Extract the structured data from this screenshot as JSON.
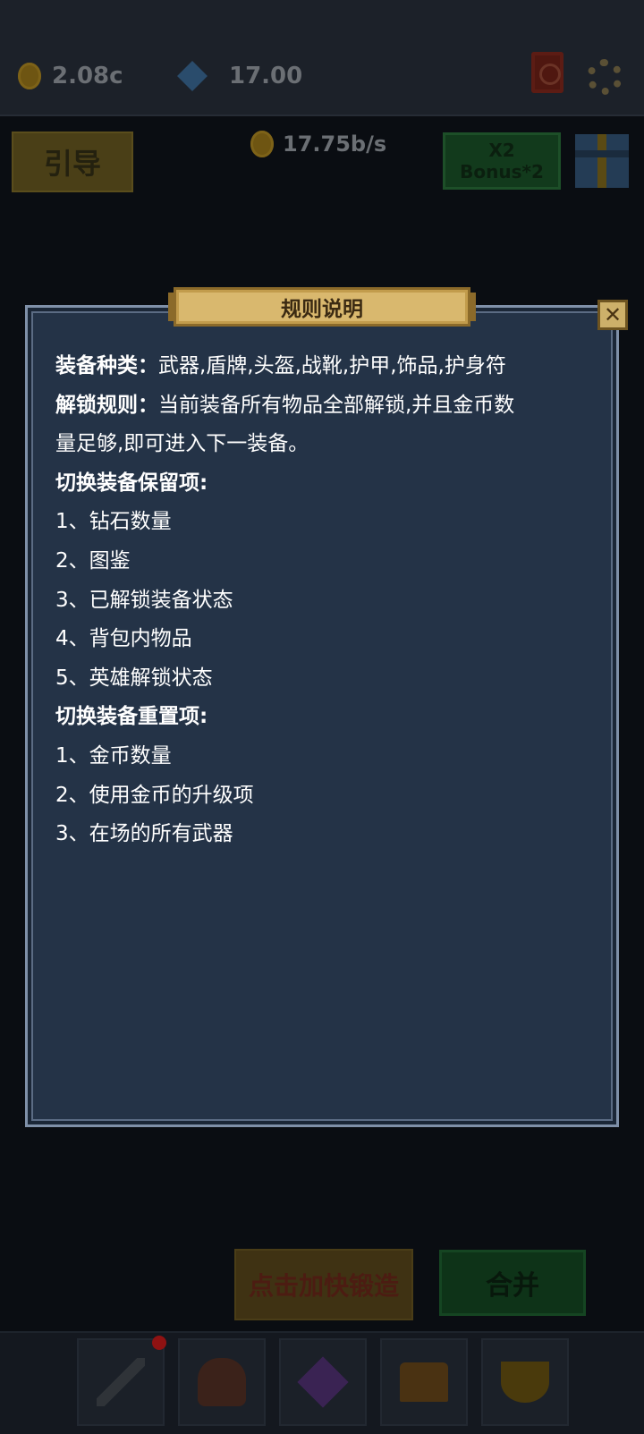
{
  "hud": {
    "gold": "2.08c",
    "diamonds": "17.00",
    "gold_rate": "17.75b/s"
  },
  "buttons": {
    "guide": "引导",
    "bonus_line1": "X2",
    "bonus_line2": "Bonus*2",
    "forge": "点击加快锻造",
    "merge": "合并"
  },
  "modal": {
    "title": "规则说明",
    "close": "✕",
    "equip_types_label": "装备种类：",
    "equip_types_value": "武器,盾牌,头盔,战靴,护甲,饰品,护身符",
    "unlock_rule_label": "解锁规则：",
    "unlock_rule_value_1": "当前装备所有物品全部解锁,并且金币数",
    "unlock_rule_value_2": "量足够,即可进入下一装备。",
    "keep_heading": "切换装备保留项:",
    "keep_items": [
      "1、钻石数量",
      "2、图鉴",
      "3、已解锁装备状态",
      "4、背包内物品",
      "5、英雄解锁状态"
    ],
    "reset_heading": "切换装备重置项:",
    "reset_items": [
      "1、金币数量",
      "2、使用金币的升级项",
      "3、在场的所有武器"
    ]
  },
  "icons": {
    "gold": "coin-icon",
    "diamond": "diamond-icon",
    "book": "book-icon",
    "settings": "gear-icon",
    "gift": "gift-icon",
    "tabs": [
      "sword-icon",
      "helmet-icon",
      "gem-icon",
      "chest-icon",
      "trophy-icon"
    ]
  },
  "colors": {
    "modal_bg": "#243347",
    "title_plate": "#d9b86e",
    "text": "#ffffff"
  }
}
